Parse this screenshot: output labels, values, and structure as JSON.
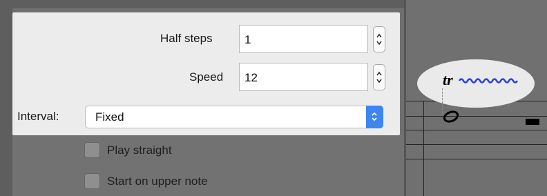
{
  "trill_panel": {
    "half_steps": {
      "label": "Half steps",
      "value": "1"
    },
    "speed": {
      "label": "Speed",
      "value": "12"
    },
    "interval": {
      "label": "Interval:",
      "selected": "Fixed"
    }
  },
  "options": {
    "play_straight": {
      "label": "Play straight",
      "checked": false
    },
    "start_on_upper_note": {
      "label": "Start on upper note",
      "checked": false
    }
  },
  "score": {
    "trill_symbol": "tr",
    "trill_line_color": "#2a3fe0"
  }
}
